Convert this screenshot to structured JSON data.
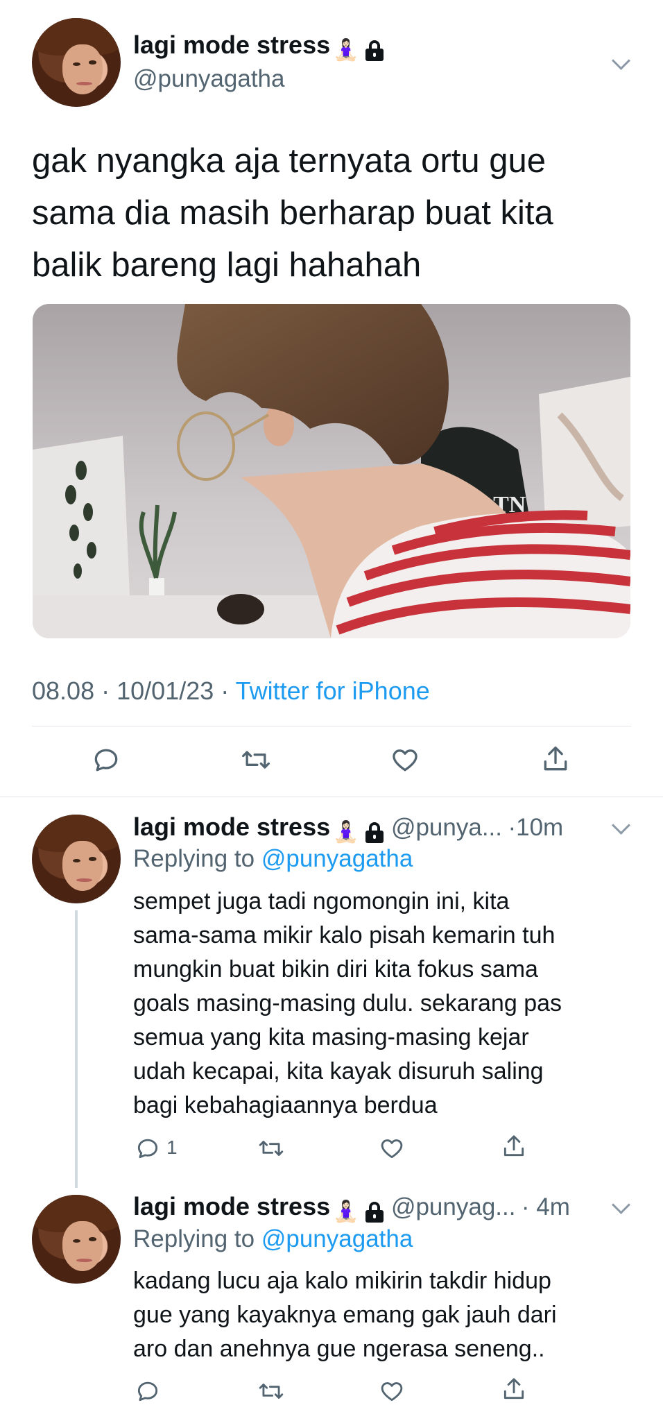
{
  "main_tweet": {
    "author_name": "lagi mode stress",
    "author_emoji": "🧘🏻‍♀️",
    "handle": "@punyagatha",
    "text_lines": [
      "gak nyangka aja ternyata ortu gue",
      "sama dia masih berharap buat kita",
      "balik bareng lagi hahahah"
    ],
    "time": "08.08",
    "date": "10/01/23",
    "sep": "·",
    "source": "Twitter for iPhone",
    "image_icons": {
      "reply": "reply-icon",
      "retweet": "retweet-icon",
      "like": "like-icon",
      "share": "share-icon"
    },
    "image_sign_text": "VLTN"
  },
  "replies": [
    {
      "author_name": "lagi mode stress",
      "author_emoji": "🧘🏻‍♀️",
      "handle": "@punya...",
      "time": "·10m",
      "replying_prefix": "Replying to",
      "replying_to": "@punyagatha",
      "text_lines": [
        "sempet juga tadi ngomongin ini, kita",
        "sama-sama mikir kalo pisah kemarin tuh",
        "mungkin buat bikin diri kita fokus sama",
        "goals masing-masing dulu. sekarang pas",
        "semua yang kita masing-masing kejar",
        "udah kecapai, kita kayak disuruh saling",
        "bagi kebahagiaannya berdua"
      ],
      "reply_count": "1"
    },
    {
      "author_name": "lagi mode stress",
      "author_emoji": "🧘🏻‍♀️",
      "handle": "@punyag...",
      "time": "· 4m",
      "replying_prefix": "Replying to",
      "replying_to": "@punyagatha",
      "text_lines": [
        "kadang lucu aja kalo mikirin takdir hidup",
        "gue yang kayaknya emang gak jauh dari",
        "aro dan anehnya gue ngerasa seneng.."
      ]
    }
  ],
  "colors": {
    "accent": "#1d9bf0",
    "secondary_text": "#536471",
    "icon": "#536471",
    "divider": "#e1e5e9"
  }
}
